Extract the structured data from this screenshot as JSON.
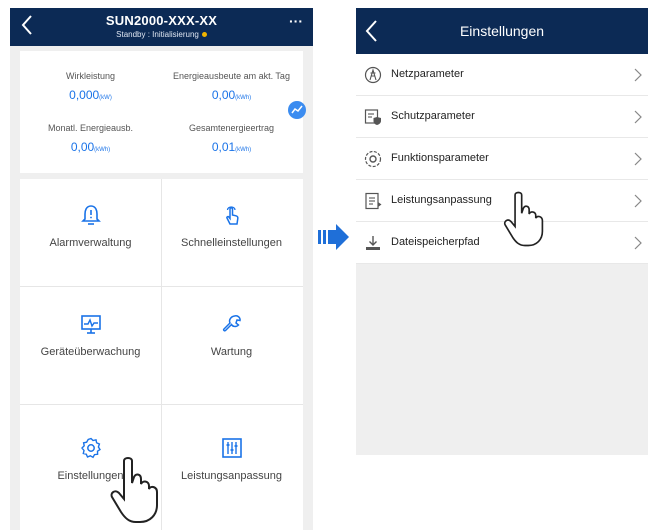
{
  "left_screen": {
    "title": "SUN2000-XXX-XX",
    "status_text": "Standby : Initialisierung",
    "colors": {
      "header": "#0c2a55",
      "accent": "#1a73e8",
      "status_dot": "#f0b400"
    },
    "stats": [
      {
        "label": "Wirkleistung",
        "value": "0,000",
        "unit": "(kW)"
      },
      {
        "label": "Energieausbeute am akt. Tag",
        "value": "0,00",
        "unit": "(kWh)"
      },
      {
        "label": "Monatl. Energieausb.",
        "value": "0,00",
        "unit": "(kWh)"
      },
      {
        "label": "Gesamtenergieertrag",
        "value": "0,01",
        "unit": "(kWh)"
      }
    ],
    "tiles": [
      {
        "label": "Alarmverwaltung",
        "icon": "alarm-bell-icon"
      },
      {
        "label": "Schnelleinstellungen",
        "icon": "touch-hand-icon"
      },
      {
        "label": "Geräteüberwachung",
        "icon": "monitor-icon"
      },
      {
        "label": "Wartung",
        "icon": "wrench-icon"
      },
      {
        "label": "Einstellungen",
        "icon": "gear-icon"
      },
      {
        "label": "Leistungsanpassung",
        "icon": "sliders-icon"
      }
    ]
  },
  "right_screen": {
    "title": "Einstellungen",
    "menu": [
      {
        "label": "Netzparameter",
        "icon": "grid-tower-icon"
      },
      {
        "label": "Schutzparameter",
        "icon": "shield-settings-icon"
      },
      {
        "label": "Funktionsparameter",
        "icon": "function-settings-icon"
      },
      {
        "label": "Leistungsanpassung",
        "icon": "power-adjust-icon"
      },
      {
        "label": "Dateispeicherpfad",
        "icon": "download-path-icon"
      }
    ]
  }
}
